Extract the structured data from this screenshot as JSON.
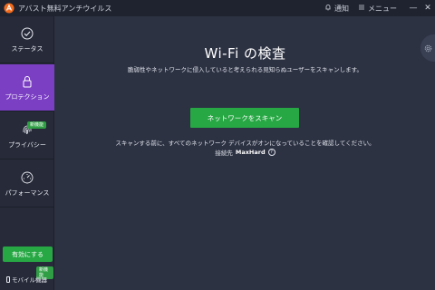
{
  "titlebar": {
    "app_title": "アバスト無料アンチウイルス",
    "notifications_label": "通知",
    "menu_label": "メニュー",
    "minimize": "—",
    "close": "✕"
  },
  "sidebar": {
    "items": [
      {
        "label": "ステータス",
        "icon": "check-circle-icon"
      },
      {
        "label": "プロテクション",
        "icon": "lock-icon"
      },
      {
        "label": "プライバシー",
        "icon": "fingerprint-icon",
        "badge": "新機能"
      },
      {
        "label": "パフォーマンス",
        "icon": "speedometer-icon"
      }
    ],
    "enable_button": "有効にする",
    "mobile_badge": "新機能",
    "mobile_label": "モバイル機器"
  },
  "main": {
    "title": "Wi-Fi の検査",
    "description": "脆弱性やネットワークに侵入していると考えられる見知らぬユーザーをスキャンします。",
    "scan_button": "ネットワークをスキャン",
    "note": "スキャンする前に、すべてのネットワーク デバイスがオンになっていることを確認してください。",
    "connected_prefix": "接続先",
    "network_name": "MaxHard",
    "help": "?"
  },
  "colors": {
    "accent_purple": "#7b3fc4",
    "accent_green": "#27a844",
    "background": "#2d3243",
    "sidebar": "#262a39"
  }
}
